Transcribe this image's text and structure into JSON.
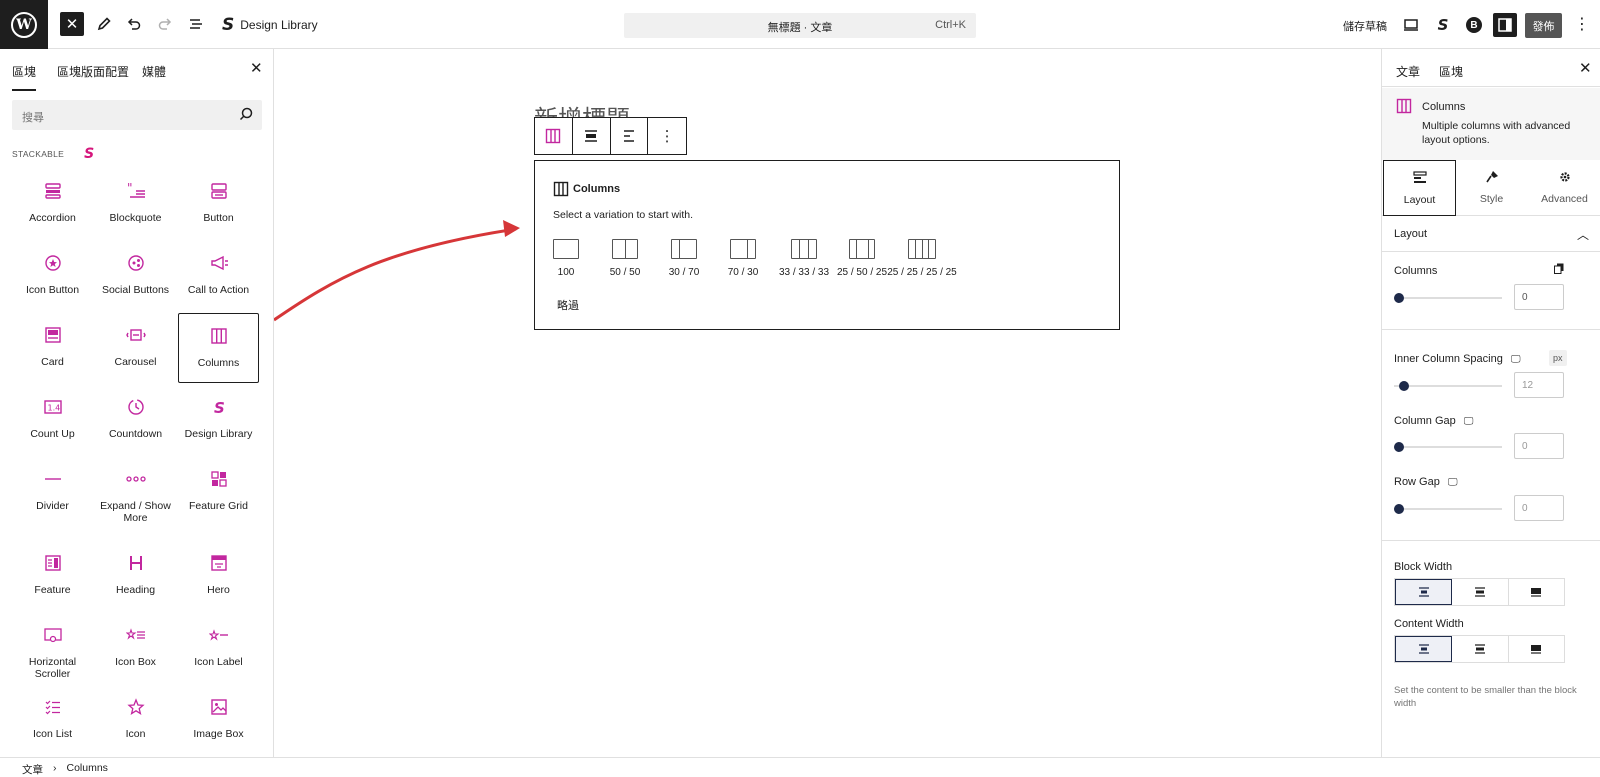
{
  "topbar": {
    "design_library": "Design Library",
    "command_title": "無標題 · 文章",
    "command_shortcut": "Ctrl+K",
    "save_draft": "儲存草稿",
    "publish": "發佈"
  },
  "inserter": {
    "tabs": [
      "區塊",
      "區塊版面配置",
      "媒體"
    ],
    "search_placeholder": "搜尋",
    "category": "STACKABLE",
    "blocks": [
      {
        "label": "Accordion",
        "icon": "accordion-icon"
      },
      {
        "label": "Blockquote",
        "icon": "blockquote-icon"
      },
      {
        "label": "Button",
        "icon": "button-icon"
      },
      {
        "label": "Icon Button",
        "icon": "icon-button-icon"
      },
      {
        "label": "Social Buttons",
        "icon": "social-buttons-icon"
      },
      {
        "label": "Call to Action",
        "icon": "megaphone-icon"
      },
      {
        "label": "Card",
        "icon": "card-icon"
      },
      {
        "label": "Carousel",
        "icon": "carousel-icon"
      },
      {
        "label": "Columns",
        "icon": "columns-icon"
      },
      {
        "label": "Count Up",
        "icon": "count-up-icon"
      },
      {
        "label": "Countdown",
        "icon": "countdown-icon"
      },
      {
        "label": "Design Library",
        "icon": "stackable-logo-icon"
      },
      {
        "label": "Divider",
        "icon": "divider-icon"
      },
      {
        "label": "Expand / Show More",
        "icon": "expand-icon"
      },
      {
        "label": "Feature Grid",
        "icon": "feature-grid-icon"
      },
      {
        "label": "Feature",
        "icon": "feature-icon"
      },
      {
        "label": "Heading",
        "icon": "heading-icon"
      },
      {
        "label": "Hero",
        "icon": "hero-icon"
      },
      {
        "label": "Horizontal Scroller",
        "icon": "horizontal-scroller-icon"
      },
      {
        "label": "Icon Box",
        "icon": "icon-box-icon"
      },
      {
        "label": "Icon Label",
        "icon": "icon-label-icon"
      },
      {
        "label": "Icon List",
        "icon": "icon-list-icon"
      },
      {
        "label": "Icon",
        "icon": "star-icon"
      },
      {
        "label": "Image Box",
        "icon": "image-box-icon"
      }
    ]
  },
  "canvas": {
    "ghost_title": "新增標題",
    "placeholder": {
      "title": "Columns",
      "subtitle": "Select a variation to start with.",
      "variations": [
        "100",
        "50 / 50",
        "30 / 70",
        "70 / 30",
        "33 / 33 / 33",
        "25 / 50 / 25",
        "25 / 25 / 25 / 25"
      ],
      "skip": "略過"
    },
    "arrow_color": "#d63638"
  },
  "sidebar": {
    "tabs": [
      "文章",
      "區塊"
    ],
    "block_name": "Columns",
    "block_desc": "Multiple columns with advanced layout options.",
    "style_tabs": [
      "Layout",
      "Style",
      "Advanced"
    ],
    "panel_title": "Layout",
    "columns_label": "Columns",
    "columns_value": "0",
    "inner_spacing_label": "Inner Column Spacing",
    "inner_spacing_unit": "px",
    "inner_spacing_value": "12",
    "column_gap_label": "Column Gap",
    "column_gap_value": "0",
    "row_gap_label": "Row Gap",
    "row_gap_value": "0",
    "block_width_label": "Block Width",
    "content_width_label": "Content Width",
    "content_width_help": "Set the content to be smaller than the block width"
  },
  "footer": {
    "breadcrumb": [
      "文章",
      "Columns"
    ]
  },
  "colors": {
    "accent": "#c2279f",
    "dark": "#1e1e1e",
    "knob": "#1e2a4a"
  }
}
